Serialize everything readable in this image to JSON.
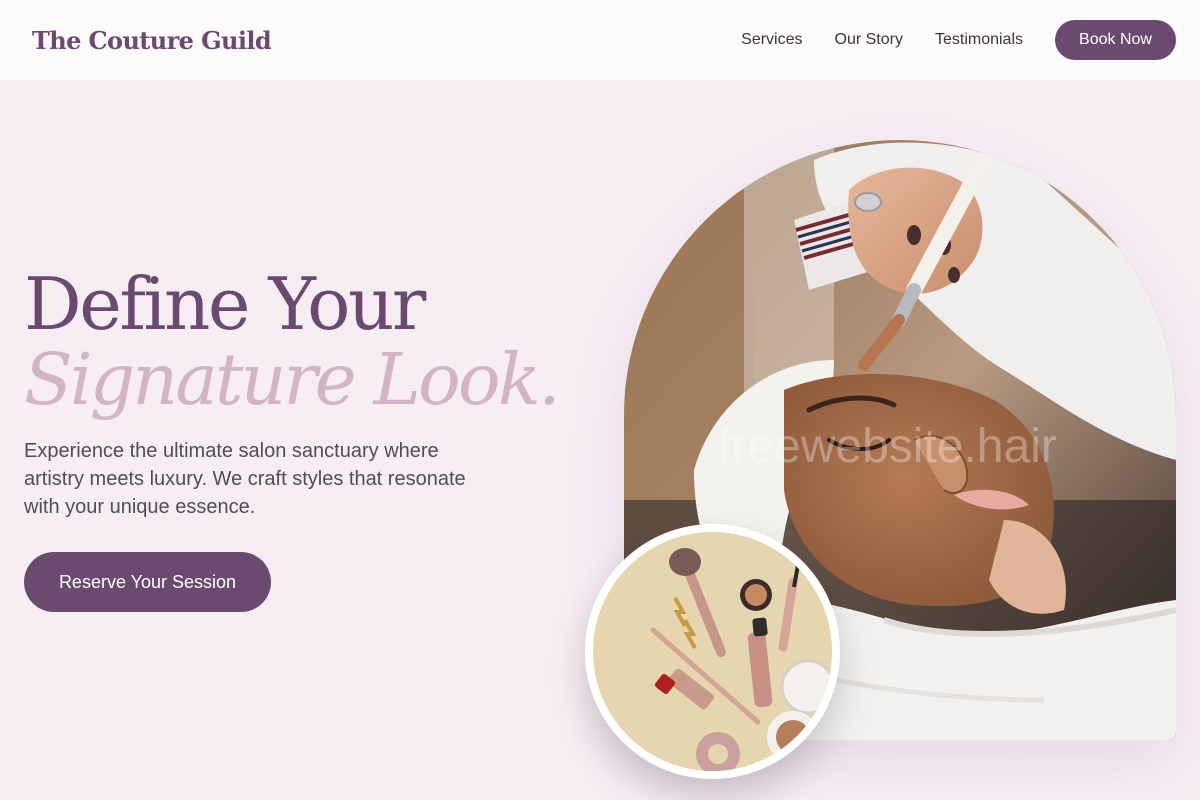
{
  "brand": {
    "logo_text": "The Couture Guild"
  },
  "nav": {
    "links": [
      "Services",
      "Our Story",
      "Testimonials"
    ],
    "book_label": "Book Now"
  },
  "hero": {
    "title_line1": "Define Your",
    "title_line2": "Signature Look.",
    "description": "Experience the ultimate salon sanctuary where artistry meets luxury. We craft styles that resonate with your unique essence.",
    "cta_label": "Reserve Your Session"
  },
  "images": {
    "main_photo_watermark": "freewebsite.hair",
    "main_photo": "facial-treatment-photo",
    "inset_photo": "makeup-flatlay-photo"
  },
  "colors": {
    "accent": "#6b4a6f",
    "accent_light": "#d3b3c6",
    "background": "#f7eef4",
    "header_bg": "#fdfafc",
    "body_text": "#524c58"
  }
}
